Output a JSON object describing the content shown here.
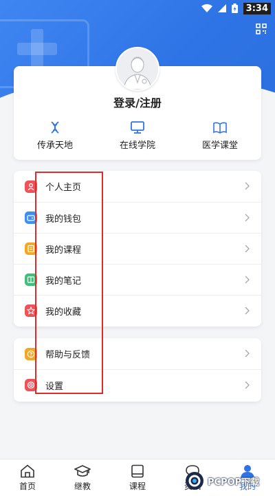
{
  "status_bar": {
    "time": "3:34"
  },
  "profile": {
    "login_label": "登录/注册"
  },
  "quick_links": [
    {
      "label": "传承天地",
      "icon": "dna-icon"
    },
    {
      "label": "在线学院",
      "icon": "monitor-icon"
    },
    {
      "label": "医学课堂",
      "icon": "book-icon"
    }
  ],
  "menu_main": [
    {
      "label": "个人主页",
      "icon": "person-icon",
      "color": "#f0525a"
    },
    {
      "label": "我的钱包",
      "icon": "wallet-icon",
      "color": "#3d8ff0"
    },
    {
      "label": "我的课程",
      "icon": "course-icon",
      "color": "#f5a623"
    },
    {
      "label": "我的笔记",
      "icon": "note-icon",
      "color": "#3fbf7a"
    },
    {
      "label": "我的收藏",
      "icon": "star-icon",
      "color": "#f0525a"
    }
  ],
  "menu_other": [
    {
      "label": "帮助与反馈",
      "icon": "help-icon",
      "color": "#f5a623"
    },
    {
      "label": "设置",
      "icon": "settings-icon",
      "color": "#f0525a"
    }
  ],
  "bottom_nav": [
    {
      "label": "首页",
      "icon": "home-icon"
    },
    {
      "label": "继教",
      "icon": "graduation-cap-icon"
    },
    {
      "label": "课程",
      "icon": "course-book-icon"
    },
    {
      "label": "资讯",
      "icon": "chat-icon"
    },
    {
      "label": "我的",
      "icon": "user-icon",
      "active": true
    }
  ],
  "watermark": {
    "text": "PCPOP下载"
  },
  "colors": {
    "primary": "#2f74e6",
    "highlight": "#e02a2a"
  }
}
